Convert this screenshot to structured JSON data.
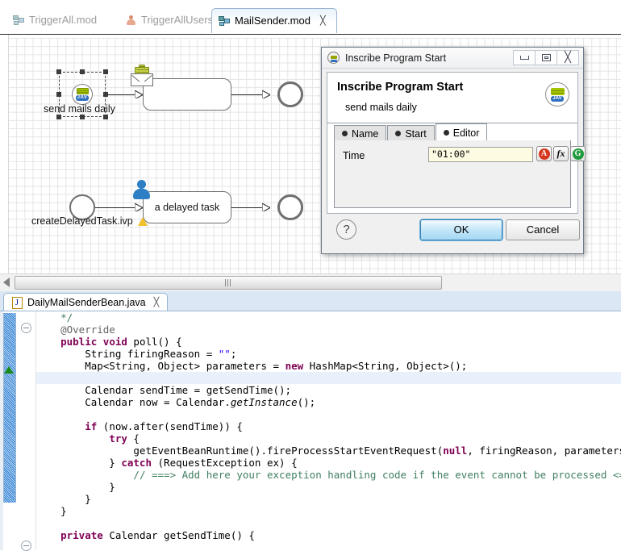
{
  "editor_tabs": [
    {
      "label": "TriggerAll.mod",
      "icon": "process-mod-icon",
      "active": false,
      "closable": false
    },
    {
      "label": "TriggerAllUsers",
      "icon": "user-icon",
      "active": false,
      "closable": false
    },
    {
      "label": "MailSender.mod",
      "icon": "process-mod-icon",
      "active": true,
      "closable": true,
      "close": "╳"
    }
  ],
  "diagram": {
    "top_flow": {
      "start_label": "send mails daily",
      "start_icon": "ivy-java-start-icon",
      "step_icon": "mail-task-icon",
      "step_label": "",
      "end_icon": "end-node-icon"
    },
    "bottom_flow": {
      "start_label": "createDelayedTask.ivp",
      "start_icon": "start-node-icon",
      "step_icon": "user-task-icon",
      "step_label": "a delayed task",
      "warning_icon": "warning-triangle-icon",
      "end_icon": "end-node-icon"
    },
    "hscroll": {
      "left_arrow": "scroll-left-arrow-icon",
      "grip": "scroll-grip-icon"
    }
  },
  "dialog": {
    "window_title": "Inscribe Program Start",
    "window_icon": "ivy-process-icon",
    "buttons": {
      "minimize": "minimize-icon",
      "restore": "restore-icon",
      "close": "╳"
    },
    "header_title": "Inscribe Program Start",
    "header_subtitle": "send mails daily",
    "header_icon": "ivy-java-badge-icon",
    "tabs": [
      {
        "label": "Name",
        "selected": false
      },
      {
        "label": "Start",
        "selected": false
      },
      {
        "label": "Editor",
        "selected": true
      }
    ],
    "field_label": "Time",
    "field_value": "\"01:00\"",
    "field_buttons": [
      {
        "name": "attribute-picker-button",
        "glyph": "A"
      },
      {
        "name": "function-picker-button",
        "glyph": "fx"
      },
      {
        "name": "global-picker-button",
        "glyph": "G"
      }
    ],
    "help_label": "?",
    "ok_label": "OK",
    "cancel_label": "Cancel"
  },
  "java_editor": {
    "tab": {
      "label": "DailyMailSenderBean.java",
      "icon": "java-file-icon",
      "close": "╳"
    },
    "lines": [
      [
        {
          "t": "    */",
          "c": "cmt"
        }
      ],
      [
        {
          "t": "    @Override",
          "c": "ann"
        }
      ],
      [
        {
          "t": "    ",
          "c": "pln"
        },
        {
          "t": "public",
          "c": "kw"
        },
        {
          "t": " ",
          "c": "pln"
        },
        {
          "t": "void",
          "c": "kw"
        },
        {
          "t": " poll() {",
          "c": "pln"
        }
      ],
      [
        {
          "t": "        String firingReason = ",
          "c": "pln"
        },
        {
          "t": "\"\"",
          "c": "str"
        },
        {
          "t": ";",
          "c": "pln"
        }
      ],
      [
        {
          "t": "        Map<String, Object> parameters = ",
          "c": "pln"
        },
        {
          "t": "new",
          "c": "kw"
        },
        {
          "t": " HashMap<String, Object>();",
          "c": "pln"
        }
      ],
      [
        {
          "t": "",
          "c": "pln"
        }
      ],
      [
        {
          "t": "        Calendar sendTime = getSendTime();",
          "c": "pln"
        }
      ],
      [
        {
          "t": "        Calendar now = Calendar.",
          "c": "pln"
        },
        {
          "t": "getInstance",
          "c": "ita"
        },
        {
          "t": "();",
          "c": "pln"
        }
      ],
      [
        {
          "t": "",
          "c": "pln"
        }
      ],
      [
        {
          "t": "        ",
          "c": "pln"
        },
        {
          "t": "if",
          "c": "kw"
        },
        {
          "t": " (now.after(sendTime)) {",
          "c": "pln"
        }
      ],
      [
        {
          "t": "            ",
          "c": "pln"
        },
        {
          "t": "try",
          "c": "kw"
        },
        {
          "t": " {",
          "c": "pln"
        }
      ],
      [
        {
          "t": "                getEventBeanRuntime().fireProcessStartEventRequest(",
          "c": "pln"
        },
        {
          "t": "null",
          "c": "kw"
        },
        {
          "t": ", firingReason, parameters);",
          "c": "pln"
        }
      ],
      [
        {
          "t": "            } ",
          "c": "pln"
        },
        {
          "t": "catch",
          "c": "kw"
        },
        {
          "t": " (RequestException ex) {",
          "c": "pln"
        }
      ],
      [
        {
          "t": "                ",
          "c": "pln"
        },
        {
          "t": "// ===> Add here your exception handling code if the event cannot be processed <===",
          "c": "cmt"
        }
      ],
      [
        {
          "t": "            }",
          "c": "pln"
        }
      ],
      [
        {
          "t": "        }",
          "c": "pln"
        }
      ],
      [
        {
          "t": "    }",
          "c": "pln"
        }
      ],
      [
        {
          "t": "",
          "c": "pln"
        }
      ],
      [
        {
          "t": "    ",
          "c": "pln"
        },
        {
          "t": "private",
          "c": "kw"
        },
        {
          "t": " Calendar getSendTime() {",
          "c": "pln"
        }
      ]
    ],
    "highlight_line_index": 5
  }
}
